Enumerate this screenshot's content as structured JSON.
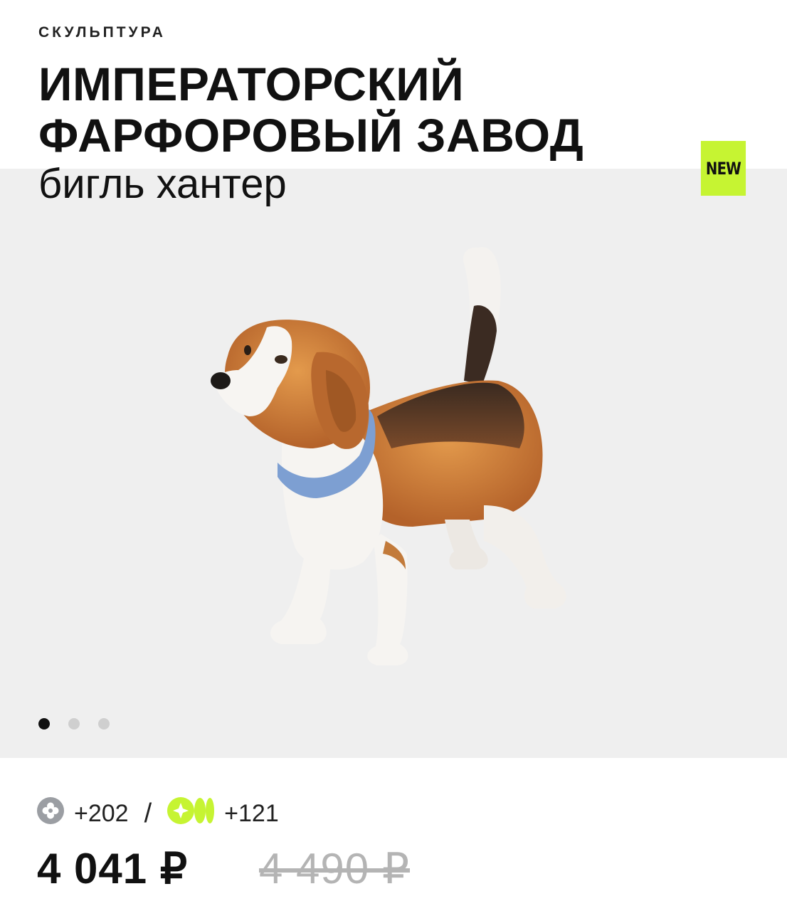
{
  "header": {
    "category": "СКУЛЬПТУРА",
    "brand_line1": "ИМПЕРАТОРСКИЙ",
    "brand_line2": "ФАРФОРОВЫЙ ЗАВОД",
    "product_name": "бигль хантер"
  },
  "badge": {
    "label": "NEW",
    "color": "#c6f432"
  },
  "gallery": {
    "image_icon": "beagle-figurine-image",
    "dots": [
      true,
      false,
      false
    ]
  },
  "bonus": {
    "points_a": "+202",
    "separator": "/",
    "points_b": "+121",
    "icon_a": "clover-icon",
    "icon_b": "cashback-icon"
  },
  "price": {
    "current": "4 041 ₽",
    "old": "4 490 ₽"
  },
  "colors": {
    "accent": "#c6f432",
    "gallery_bg": "#efefef",
    "old_price": "#b4b4b4"
  }
}
